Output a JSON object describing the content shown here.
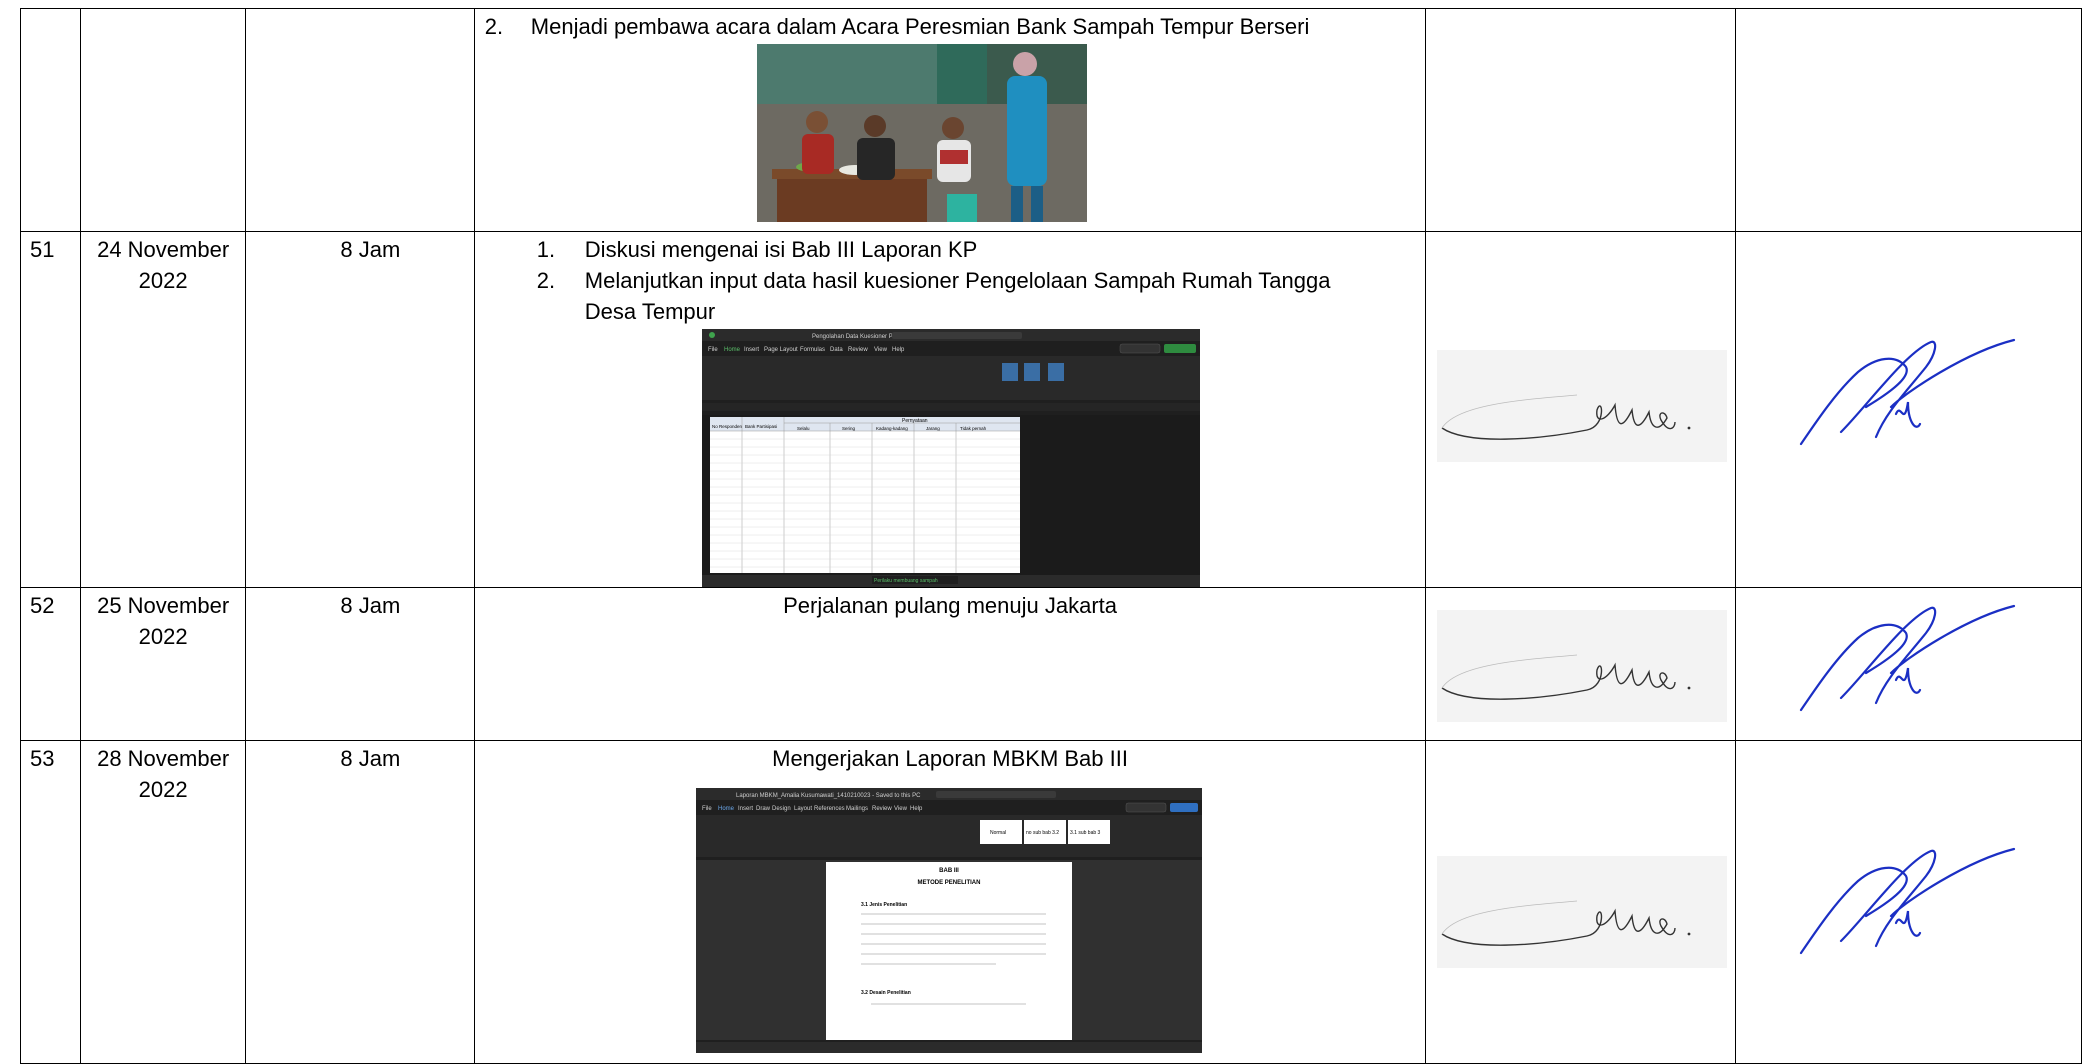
{
  "rows": [
    {
      "no": "",
      "date": "",
      "duration": "",
      "activities": [
        {
          "num": "2.",
          "text": "Menjadi pembawa acara dalam Acara Peresmian Bank Sampah Tempur Berseri"
        }
      ],
      "image": "event-photo"
    },
    {
      "no": "51",
      "date": "24 November 2022",
      "duration": "8 Jam",
      "activities": [
        {
          "num": "1.",
          "text": "Diskusi mengenai isi Bab III Laporan KP"
        },
        {
          "num": "2.",
          "text": "Melanjutkan input data hasil kuesioner Pengelolaan Sampah Rumah Tangga Desa Tempur"
        }
      ],
      "image": "excel-screenshot"
    },
    {
      "no": "52",
      "date": "25 November 2022",
      "duration": "8 Jam",
      "activity_single": "Perjalanan pulang menuju Jakarta"
    },
    {
      "no": "53",
      "date": "28 November 2022",
      "duration": "8 Jam",
      "activity_single": "Mengerjakan Laporan MBKM Bab III",
      "image": "word-screenshot"
    }
  ],
  "excel_screenshot": {
    "app_title": "Pengolahan Data Kuesioner Phased Behavior",
    "menu": [
      "File",
      "Home",
      "Insert",
      "Page Layout",
      "Formulas",
      "Data",
      "Review",
      "View",
      "Help"
    ],
    "headers": [
      "No Responden",
      "Bank Partisipasi",
      "Selalu",
      "Sering",
      "Kadang-kadang",
      "Jarang",
      "Tidak pernah"
    ],
    "group_header": "Pernyataan",
    "sheet_tab": "Perilaku membuang sampah"
  },
  "word_screenshot": {
    "app_title": "Laporan MBKM_Amalia Kusumawati_1410210023 - Saved to this PC",
    "menu": [
      "File",
      "Home",
      "Insert",
      "Draw",
      "Design",
      "Layout",
      "References",
      "Mailings",
      "Review",
      "View",
      "Help"
    ],
    "doc_heading": "BAB III",
    "doc_subheading": "METODE PENELITIAN",
    "section_1": "3.1 Jenis Penelitian",
    "section_2": "3.2 Desain Penelitian",
    "styles": [
      "Normal",
      "no sub bab 3.2",
      "3.1 sub bab 3"
    ]
  },
  "colors": {
    "border": "#000000",
    "signature_student": "#3a3a3a",
    "signature_supervisor": "#1b2fc4",
    "app_dark": "#1f1f1f"
  }
}
